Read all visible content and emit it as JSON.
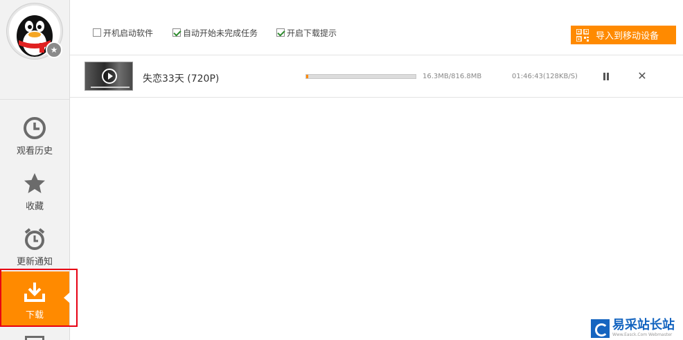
{
  "sidebar": {
    "items": [
      {
        "label": "观看历史",
        "icon": "clock-icon"
      },
      {
        "label": "收藏",
        "icon": "star-icon"
      },
      {
        "label": "更新通知",
        "icon": "alarm-clock-icon"
      },
      {
        "label": "下载",
        "icon": "download-icon",
        "active": true
      }
    ],
    "avatar_icon": "qq-penguin-avatar",
    "badge_icon": "star-badge-icon"
  },
  "options": {
    "autostart": {
      "label": "开机启动软件",
      "checked": false
    },
    "resume_tasks": {
      "label": "自动开始未完成任务",
      "checked": true
    },
    "download_tip": {
      "label": "开启下载提示",
      "checked": true
    }
  },
  "import_button": {
    "label": "导入到移动设备",
    "icon": "qr-code-icon"
  },
  "downloads": [
    {
      "title": "失恋33天 (720P)",
      "progress": 0.02,
      "size_text": "16.3MB/816.8MB",
      "eta_text": "01:46:43(128KB/S)"
    }
  ],
  "watermark": {
    "main": "易采站长站",
    "sub": "Www.Easck.Com Webmaster"
  },
  "colors": {
    "accent": "#ff8a00",
    "highlight_border": "#e60012",
    "watermark_blue": "#1565c0"
  }
}
